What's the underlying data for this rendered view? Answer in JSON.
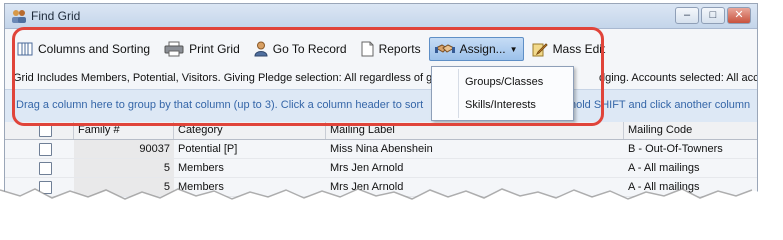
{
  "window": {
    "title": "Find Grid",
    "buttons": [
      "–",
      "□",
      "✕"
    ]
  },
  "toolbar": [
    {
      "name": "columns-and-sorting-button",
      "label": "Columns and Sorting",
      "icon": "columns-icon"
    },
    {
      "name": "print-grid-button",
      "label": "Print Grid",
      "icon": "printer-icon"
    },
    {
      "name": "go-to-record-button",
      "label": "Go To Record",
      "icon": "person-icon"
    },
    {
      "name": "reports-button",
      "label": "Reports",
      "icon": "report-icon"
    },
    {
      "name": "assign-button",
      "label": "Assign...",
      "icon": "handshake-icon"
    },
    {
      "name": "mass-edit-button",
      "label": "Mass Edit",
      "icon": "pencil-icon"
    }
  ],
  "info": {
    "text": "Grid Includes Members, Potential, Visitors.  Giving  Pledge selection: All regardless of g",
    "text_right": "dging. Accounts selected: All account"
  },
  "grouping": {
    "text": "Drag a column here to group by that column (up to 3).   Click a column header to sort",
    "text_right": "hold SHIFT and click another column."
  },
  "assign_menu": {
    "items": [
      "Groups/Classes",
      "Skills/Interests"
    ]
  },
  "columns": [
    "",
    "Family #",
    "Category",
    "Mailing Label",
    "Mailing Code"
  ],
  "rows": [
    {
      "family": "90037",
      "category": "Potential [P]",
      "label": "Miss Nina Abenshein",
      "code": "B - Out-Of-Towners"
    },
    {
      "family": "5",
      "category": "Members",
      "label": "Mrs Jen Arnold",
      "code": "A - All mailings"
    },
    {
      "family": "5",
      "category": "Members",
      "label": "Mrs Jen Arnold",
      "code": "A - All mailings"
    }
  ]
}
